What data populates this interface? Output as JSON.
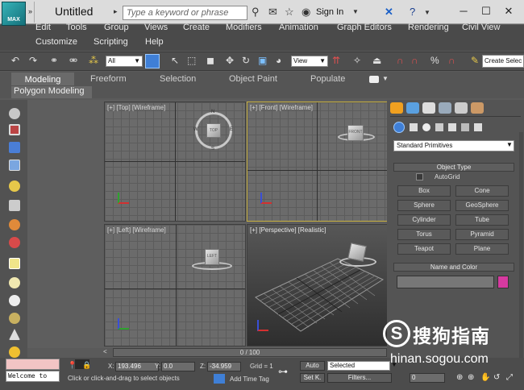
{
  "titlebar": {
    "app_logo_text": "MAX",
    "title": "Untitled",
    "search_placeholder": "Type a keyword or phrase",
    "signin_label": "Sign In"
  },
  "menu": {
    "row1": [
      "Edit",
      "Tools",
      "Group",
      "Views",
      "Create",
      "Modifiers",
      "Animation",
      "Graph Editors",
      "Rendering",
      "Civil View"
    ],
    "row2": [
      "Customize",
      "Scripting",
      "Help"
    ]
  },
  "toolbar": {
    "filter_value": "All",
    "refcoord_value": "View",
    "create_selection_label": "Create Selec"
  },
  "ribbon": {
    "tabs": [
      "Modeling",
      "Freeform",
      "Selection",
      "Object Paint",
      "Populate"
    ],
    "sub_label": "Polygon Modeling"
  },
  "viewports": {
    "top": "[+] [Top] [Wireframe]",
    "front": "[+] [Front] [Wireframe]",
    "left": "[+] [Left] [Wireframe]",
    "perspective": "[+] [Perspective] [Realistic]",
    "viewcube_top": "TOP",
    "viewcube_front": "FRONT",
    "viewcube_left": "LEFT",
    "compass_n": "N",
    "compass_s": "S",
    "compass_e": "E",
    "compass_w": "W"
  },
  "command_panel": {
    "dropdown": "Standard Primitives",
    "object_type_header": "Object Type",
    "autogrid_label": "AutoGrid",
    "primitives": [
      "Box",
      "Cone",
      "Sphere",
      "GeoSphere",
      "Cylinder",
      "Tube",
      "Torus",
      "Pyramid",
      "Teapot",
      "Plane"
    ],
    "name_color_header": "Name and Color",
    "swatch_color": "#d63aa0"
  },
  "timeline": {
    "frame_label": "0 / 100"
  },
  "status": {
    "welcome_text": "Welcome to",
    "prompt_text": "Click or click-and-drag to select objects",
    "x_label": "X:",
    "x_value": "193.496",
    "y_label": "Y:",
    "y_value": "0.0",
    "z_label": "Z:",
    "z_value": "-34.959",
    "grid_label": "Grid = 1",
    "auto_label": "Auto",
    "setk_label": "Set K.",
    "selected_value": "Selected",
    "filters_label": "Filters...",
    "add_time_tag": "Add Time Tag",
    "frame_value": "0"
  },
  "watermark": {
    "logo_char": "S",
    "text": "搜狗指南",
    "url": "hinan.sogou.com"
  }
}
